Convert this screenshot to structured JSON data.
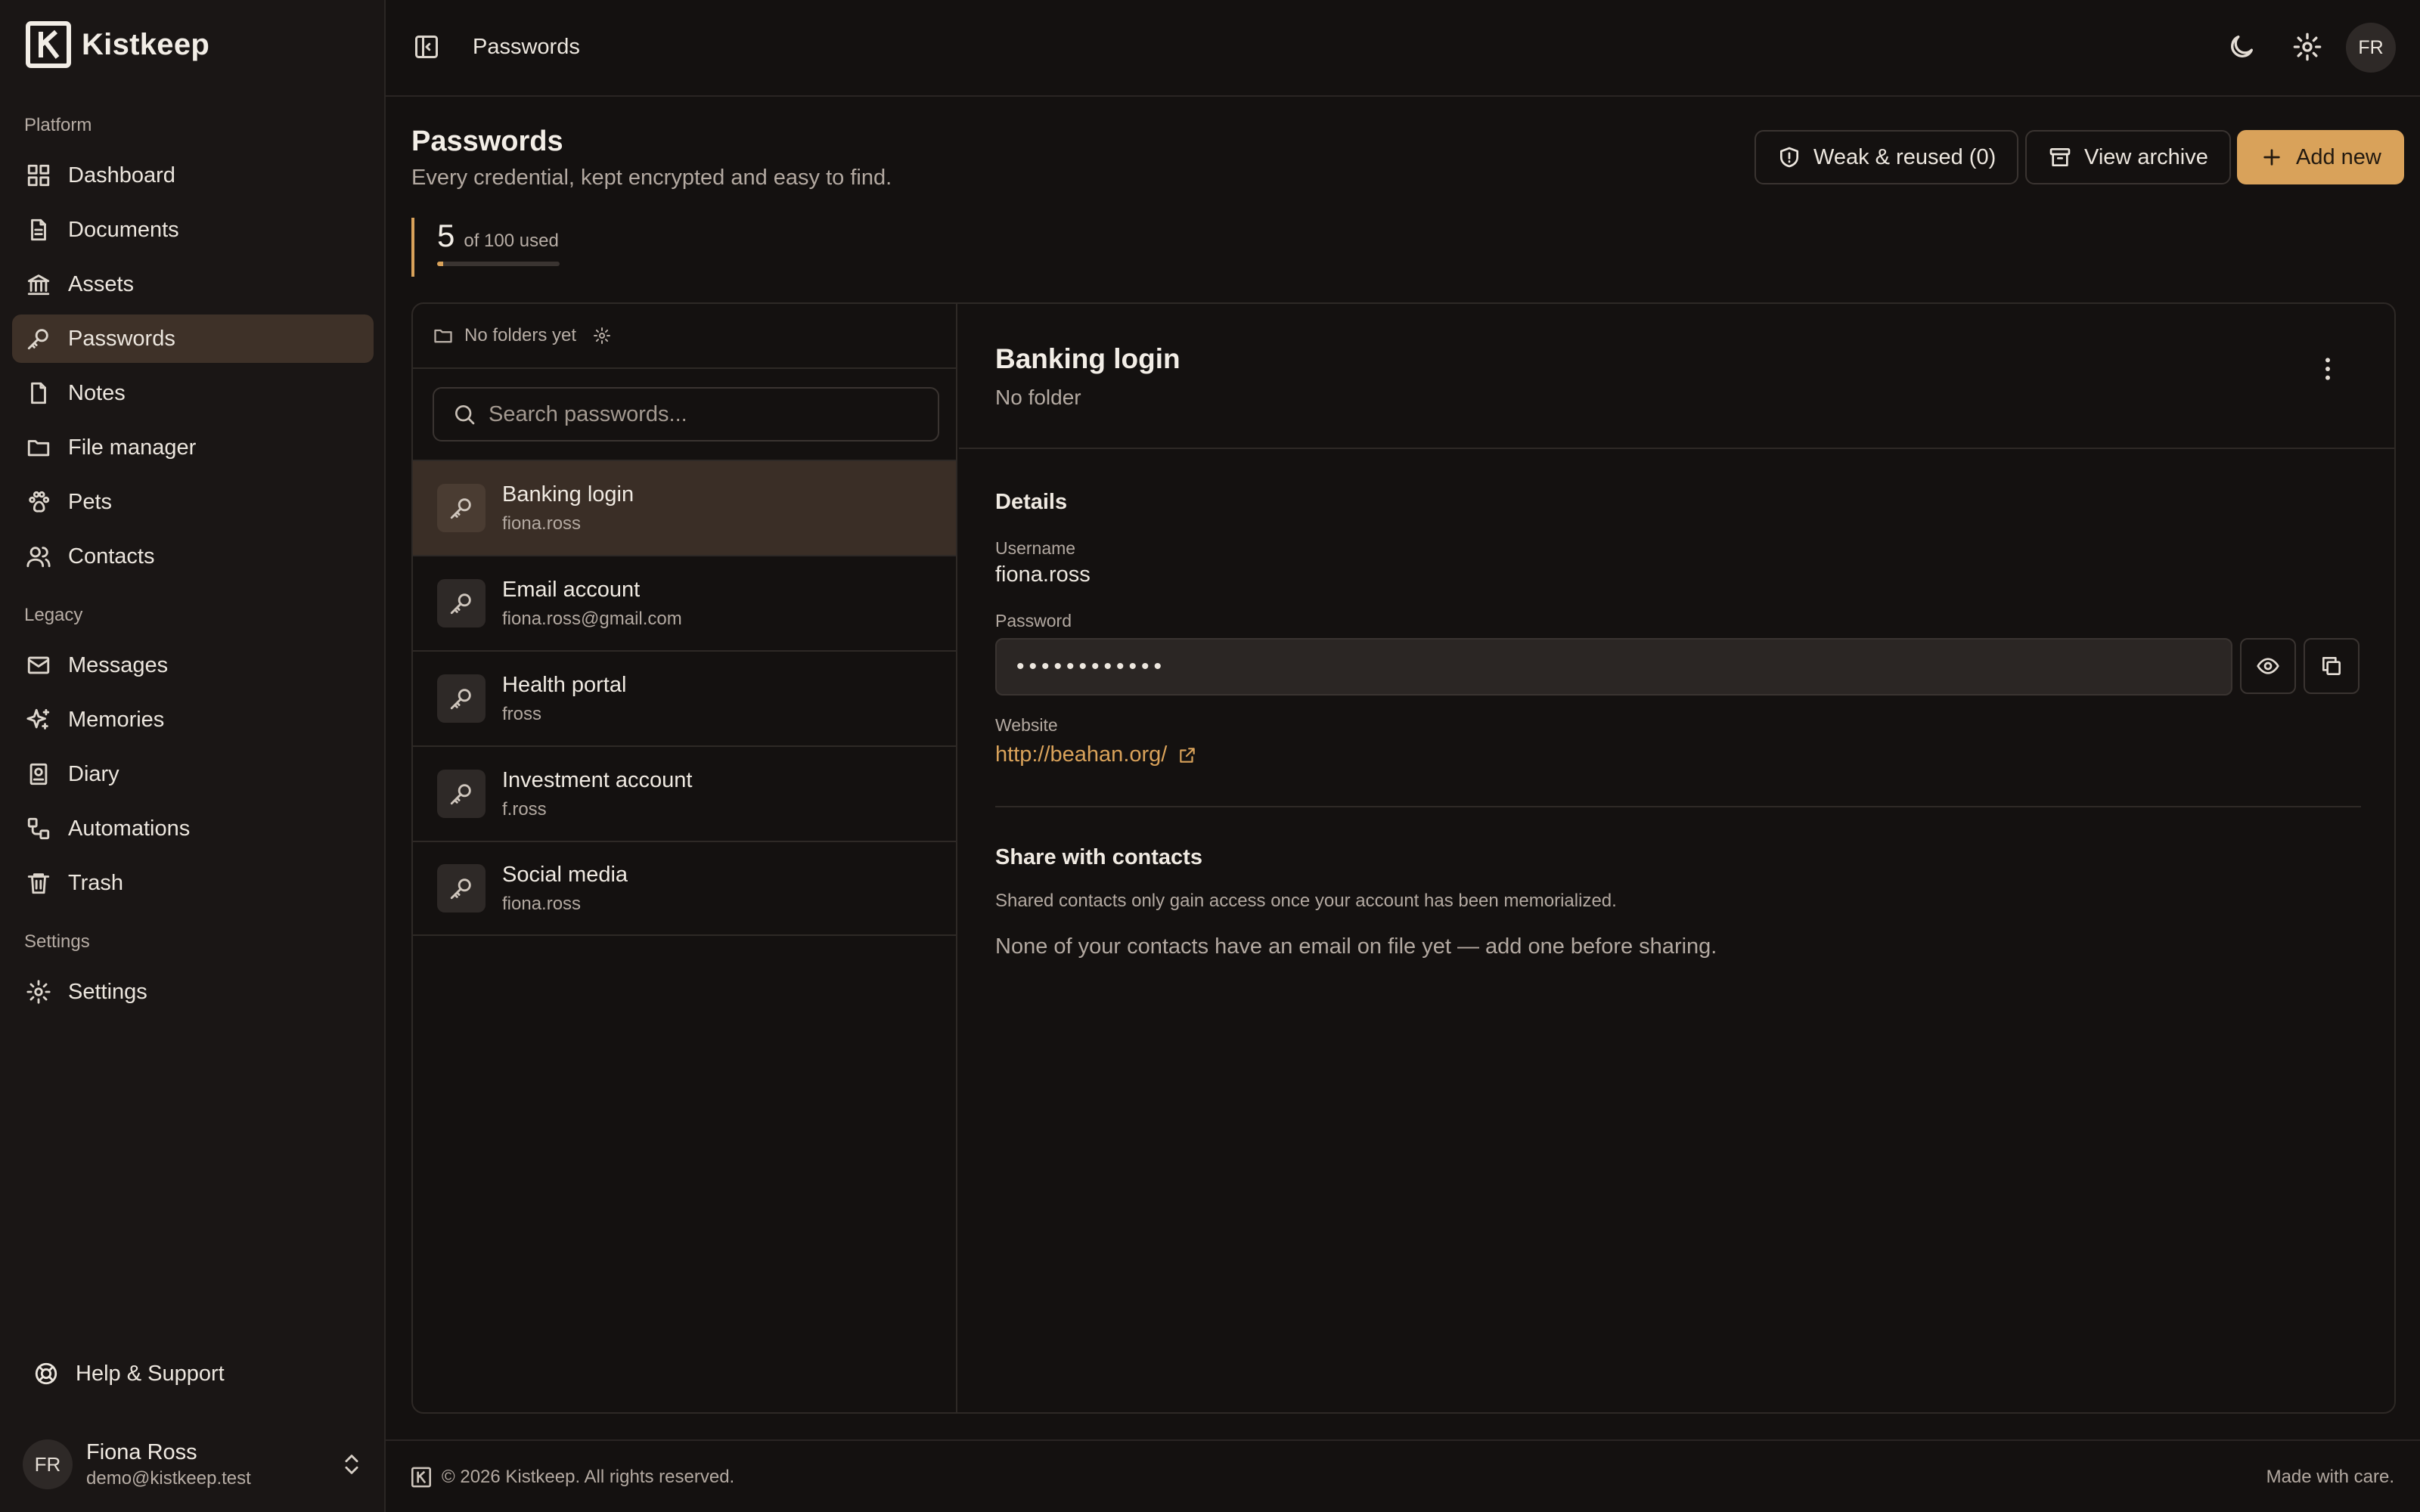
{
  "brand": {
    "name": "Kistkeep"
  },
  "sidebar": {
    "sections": {
      "platform": "Platform",
      "legacy": "Legacy",
      "settings": "Settings"
    },
    "items": [
      {
        "label": "Dashboard",
        "icon": "dashboard-icon"
      },
      {
        "label": "Documents",
        "icon": "document-icon"
      },
      {
        "label": "Assets",
        "icon": "bank-icon"
      },
      {
        "label": "Passwords",
        "icon": "key-icon",
        "active": true
      },
      {
        "label": "Notes",
        "icon": "note-icon"
      },
      {
        "label": "File manager",
        "icon": "folder-icon"
      },
      {
        "label": "Pets",
        "icon": "paw-icon"
      },
      {
        "label": "Contacts",
        "icon": "users-icon"
      },
      {
        "label": "Messages",
        "icon": "mail-icon"
      },
      {
        "label": "Memories",
        "icon": "sparkles-icon"
      },
      {
        "label": "Diary",
        "icon": "diary-icon"
      },
      {
        "label": "Automations",
        "icon": "workflow-icon"
      },
      {
        "label": "Trash",
        "icon": "trash-icon"
      },
      {
        "label": "Settings",
        "icon": "gear-icon"
      }
    ],
    "help": "Help & Support",
    "user": {
      "initials": "FR",
      "name": "Fiona Ross",
      "email": "demo@kistkeep.test"
    }
  },
  "topbar": {
    "title": "Passwords",
    "avatar": "FR"
  },
  "header": {
    "title": "Passwords",
    "subtitle": "Every credential, kept encrypted and easy to find.",
    "buttons": {
      "weak": "Weak & reused (0)",
      "archive": "View archive",
      "add": "Add new"
    }
  },
  "usage": {
    "count": "5",
    "label": "of 100 used",
    "fraction": 0.05
  },
  "list": {
    "folders": "No folders yet",
    "search_placeholder": "Search passwords...",
    "items": [
      {
        "name": "Banking login",
        "user": "fiona.ross",
        "active": true
      },
      {
        "name": "Email account",
        "user": "fiona.ross@gmail.com"
      },
      {
        "name": "Health portal",
        "user": "fross"
      },
      {
        "name": "Investment account",
        "user": "f.ross"
      },
      {
        "name": "Social media",
        "user": "fiona.ross"
      }
    ]
  },
  "detail": {
    "title": "Banking login",
    "folder": "No folder",
    "details_heading": "Details",
    "username_label": "Username",
    "username": "fiona.ross",
    "password_label": "Password",
    "password_mask": "••••••••••••",
    "website_label": "Website",
    "website": "http://beahan.org/",
    "share_heading": "Share with contacts",
    "share_note": "Shared contacts only gain access once your account has been memorialized.",
    "share_empty": "None of your contacts have an email on file yet — add one before sharing."
  },
  "footer": {
    "copyright": "© 2026 Kistkeep. All rights reserved.",
    "made": "Made with care."
  },
  "colors": {
    "accent": "#d9a25a",
    "background": "#141110",
    "sidebar": "#1a1615",
    "active_nav": "#3e3128"
  }
}
